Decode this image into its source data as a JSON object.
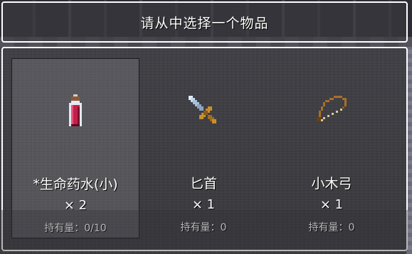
{
  "dialog": {
    "title": "请从中选择一个物品"
  },
  "items": [
    {
      "name": "*生命药水(小)",
      "quantity": "× 2",
      "owned_label": "持有量：0/10",
      "icon": "health-potion-icon",
      "selected": true
    },
    {
      "name": "匕首",
      "quantity": "× 1",
      "owned_label": "持有量：0",
      "icon": "dagger-icon",
      "selected": false
    },
    {
      "name": "小木弓",
      "quantity": "× 1",
      "owned_label": "持有量：0",
      "icon": "wooden-bow-icon",
      "selected": false
    }
  ],
  "colors": {
    "window_border": "#ffffff",
    "text": "#ffffff",
    "potion_liquid": "#c0204a",
    "dagger_blade": "#a8bfd8",
    "dagger_hilt": "#c8902a",
    "bow_wood": "#a8702a"
  }
}
